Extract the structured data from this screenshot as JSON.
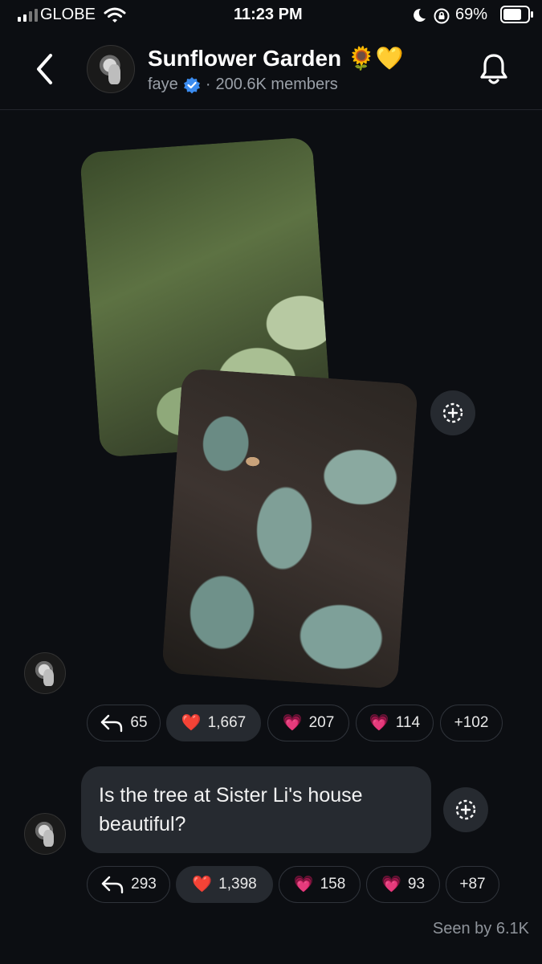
{
  "status_bar": {
    "carrier": "GLOBE",
    "time": "11:23 PM",
    "battery": "69%",
    "icons": [
      "signal-icon",
      "wifi-icon",
      "moon-icon",
      "rotation-lock-icon",
      "battery-icon"
    ]
  },
  "header": {
    "title": "Sunflower Garden 🌻💛",
    "owner": "faye",
    "members": "200.6K members",
    "separator": "·",
    "verified_color": "#3b8cf0"
  },
  "posts": [
    {
      "type": "photos",
      "images": [
        "photo of large green leaves",
        "photo of blue-green juniper shrub"
      ],
      "reactions": [
        {
          "icon": "reply-icon",
          "emoji": "",
          "count": "65"
        },
        {
          "icon": "heart",
          "emoji": "❤️",
          "count": "1,667",
          "selected": true
        },
        {
          "icon": "sparkling-heart",
          "emoji": "💗",
          "count": "207"
        },
        {
          "icon": "heart-with-ribbon",
          "emoji": "💗",
          "count": "114"
        },
        {
          "icon": "",
          "emoji": "",
          "count": "+102"
        }
      ]
    },
    {
      "type": "text",
      "text": "Is the tree at Sister Li's house beautiful?",
      "reactions": [
        {
          "icon": "reply-icon",
          "emoji": "",
          "count": "293"
        },
        {
          "icon": "heart",
          "emoji": "❤️",
          "count": "1,398",
          "selected": true
        },
        {
          "icon": "sparkling-heart",
          "emoji": "💗",
          "count": "158"
        },
        {
          "icon": "heart-with-ribbon",
          "emoji": "💗",
          "count": "93"
        },
        {
          "icon": "",
          "emoji": "",
          "count": "+87"
        }
      ]
    }
  ],
  "footer": {
    "seen": "Seen by 6.1K"
  }
}
